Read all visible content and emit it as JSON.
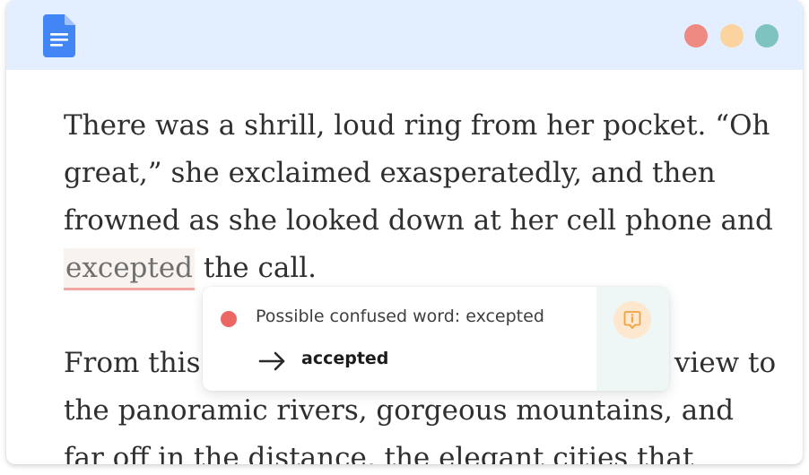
{
  "app": {
    "icon": "google-docs-icon",
    "brand_color": "#4285f4"
  },
  "window_controls": {
    "icons": [
      "close-dot",
      "minimize-dot",
      "maximize-dot"
    ],
    "colors": [
      "#ee8a82",
      "#fbd39e",
      "#7fc3c0"
    ]
  },
  "document": {
    "para1_before": "There was a shrill, loud ring from her pocket. “Oh great,” she exclaimed exasperatedly, and then frowned as she looked down at her cell phone and ",
    "flagged_word": "excepted",
    "para1_after": " the call.",
    "para2": "From this vantage point, she had a perfect view to the panoramic rivers, gorgeous mountains, and far off in the distance, the elegant cities that"
  },
  "suggestion": {
    "title": "Possible confused word: excepted",
    "replacement": "accepted",
    "severity_color": "#ec6764",
    "arrow_icon": "arrow-right-icon",
    "info_icon": "info-flag-icon",
    "info_color": "#f0a23e"
  }
}
